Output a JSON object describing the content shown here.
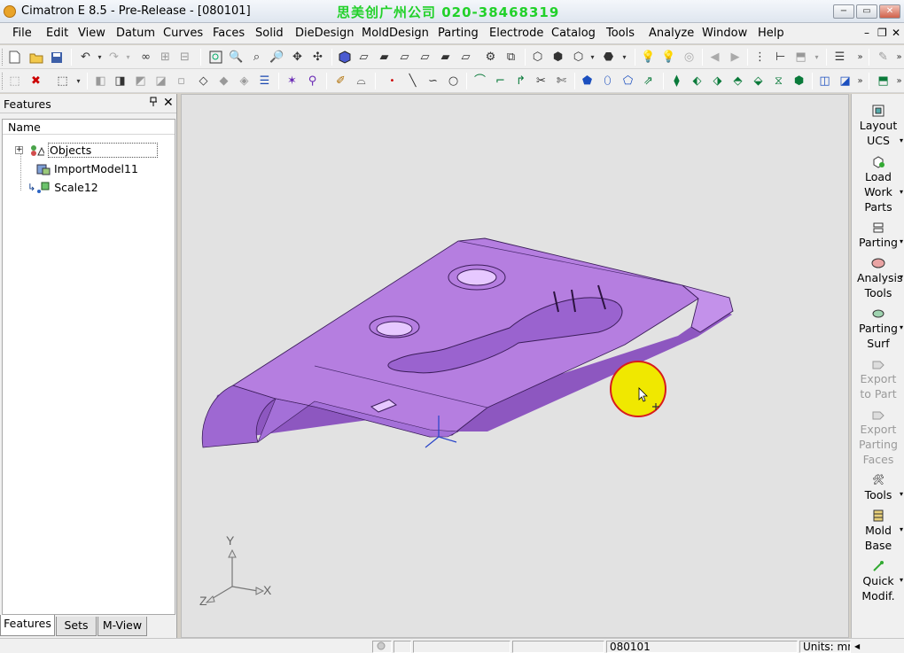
{
  "window": {
    "title": "Cimatron E 8.5 - Pre-Release - [080101]",
    "watermark": "思美创广州公司 020-38468319",
    "minimize": "−",
    "restore": "▭",
    "close": "✕"
  },
  "menu": {
    "items": [
      "File",
      "Edit",
      "View",
      "Datum",
      "Curves",
      "Faces",
      "Solid",
      "DieDesign",
      "MoldDesign",
      "Parting",
      "Electrode",
      "Catalog",
      "Tools",
      "Analyze",
      "Window",
      "Help"
    ],
    "mdi_minimize": "–",
    "mdi_restore": "❐",
    "mdi_close": "✕"
  },
  "features_panel": {
    "title": "Features",
    "pin": "📌",
    "close": "✕",
    "column_header": "Name",
    "tree": [
      {
        "label": "Objects",
        "icon": "objects-icon"
      },
      {
        "label": "ImportModel11",
        "icon": "import-model-icon"
      },
      {
        "label": "Scale12",
        "icon": "scale-icon"
      }
    ],
    "expander": "+",
    "tabs": [
      "Features",
      "Sets",
      "M-View"
    ]
  },
  "viewport": {
    "axis_labels": {
      "x": "X",
      "y": "Y",
      "z": "Z"
    },
    "colors": {
      "part_fill": "#b57ee0",
      "part_dark": "#8d57c0",
      "part_light": "#cfa4f0",
      "cursor_highlight": "#f0e800",
      "cursor_ring": "#d81c1c",
      "background": "#e2e2e2"
    }
  },
  "right_panel": {
    "items": [
      {
        "label": "Layout UCS",
        "icon": "layout-ucs-icon",
        "enabled": true
      },
      {
        "label": "Load Work Parts",
        "icon": "load-work-parts-icon",
        "enabled": true
      },
      {
        "label": "Parting",
        "icon": "parting-icon",
        "enabled": true
      },
      {
        "label": "Analysis Tools",
        "icon": "analysis-tools-icon",
        "enabled": true
      },
      {
        "label": "Parting Surf",
        "icon": "parting-surf-icon",
        "enabled": true
      },
      {
        "label": "Export to Part",
        "icon": "export-to-part-icon",
        "enabled": false
      },
      {
        "label": "Export Parting Faces",
        "icon": "export-parting-faces-icon",
        "enabled": false
      },
      {
        "label": "Tools",
        "icon": "tools-icon",
        "enabled": true
      },
      {
        "label": "Mold Base",
        "icon": "mold-base-icon",
        "enabled": true
      },
      {
        "label": "Quick Modif.",
        "icon": "quick-modif-icon",
        "enabled": true
      }
    ]
  },
  "statusbar": {
    "file_name": "080101",
    "units": "Units: mm"
  }
}
